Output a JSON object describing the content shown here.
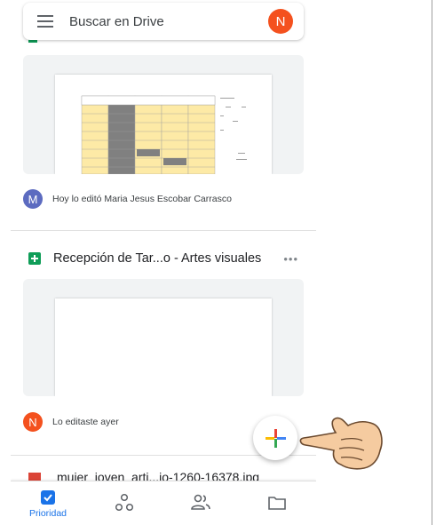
{
  "search": {
    "placeholder": "Buscar en Drive",
    "avatar_letter": "N"
  },
  "files": [
    {
      "owner_avatar_letter": "M",
      "owner_avatar_color": "#5c6bc0",
      "activity": "Hoy lo editó Maria Jesus Escobar Carrasco"
    },
    {
      "type_icon": "sheets-icon",
      "title": "Recepción de Tar...o - Artes visuales",
      "owner_avatar_letter": "N",
      "owner_avatar_color": "#f4511e",
      "activity": "Lo editaste ayer"
    },
    {
      "type_icon": "pdf-icon",
      "title": "mujer_joven_arti...io-1260-16378.jpg"
    }
  ],
  "fab": {
    "icon": "plus-icon"
  },
  "bottom_nav": {
    "items": [
      {
        "icon": "priority-checkbox-icon",
        "label": "Prioridad",
        "active": true
      },
      {
        "icon": "workspaces-icon",
        "label": ""
      },
      {
        "icon": "shared-people-icon",
        "label": ""
      },
      {
        "icon": "folder-icon",
        "label": ""
      }
    ]
  },
  "colors": {
    "accent": "#1a73e8",
    "sheets_green": "#0f9d58",
    "fab_red": "#ea4335",
    "fab_blue": "#4285f4",
    "fab_yellow": "#fbbc04",
    "fab_green": "#34a853"
  }
}
